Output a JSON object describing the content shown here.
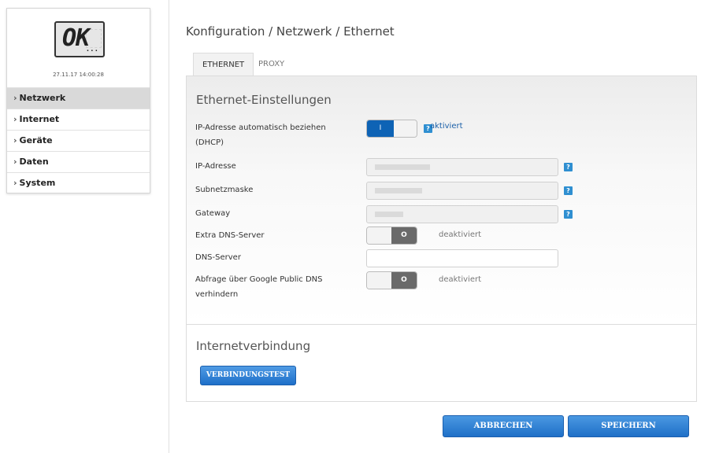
{
  "device": {
    "display_text": "OK",
    "display_dots": "...",
    "timestamp": "27.11.17 14:00:28"
  },
  "sidebar": {
    "chevron": "›",
    "items": [
      {
        "label": "Netzwerk",
        "active": true
      },
      {
        "label": "Internet",
        "active": false
      },
      {
        "label": "Geräte",
        "active": false
      },
      {
        "label": "Daten",
        "active": false
      },
      {
        "label": "System",
        "active": false
      }
    ]
  },
  "breadcrumb": "Konfiguration / Netzwerk / Ethernet",
  "tabs": [
    {
      "label": "ETHERNET",
      "active": true
    },
    {
      "label": "PROXY",
      "active": false
    }
  ],
  "ethernet": {
    "title": "Ethernet-Einstellungen",
    "dhcp": {
      "label_line1": "IP-Adresse automatisch beziehen",
      "label_line2": "(DHCP)",
      "toggle_text": "I",
      "status": "aktiviert"
    },
    "ip": {
      "label": "IP-Adresse"
    },
    "subnet": {
      "label": "Subnetzmaske"
    },
    "gateway": {
      "label": "Gateway"
    },
    "extra_dns": {
      "label": "Extra DNS-Server",
      "toggle_text": "O",
      "status": "deaktiviert"
    },
    "dns_server": {
      "label": "DNS-Server"
    },
    "google_dns": {
      "label_line1": "Abfrage über Google Public DNS",
      "label_line2": "verhindern",
      "toggle_text": "O",
      "status": "deaktiviert"
    },
    "help_glyph": "?"
  },
  "internet": {
    "title": "Internetverbindung",
    "test_button": "VERBINDUNGSTEST"
  },
  "footer": {
    "cancel": "ABBRECHEN",
    "save": "SPEICHERN"
  },
  "colors": {
    "accent_blue": "#1e6fc9",
    "toggle_on": "#0e63b5",
    "toggle_off": "#6a6a6a",
    "help_blue": "#2f8fd1"
  }
}
